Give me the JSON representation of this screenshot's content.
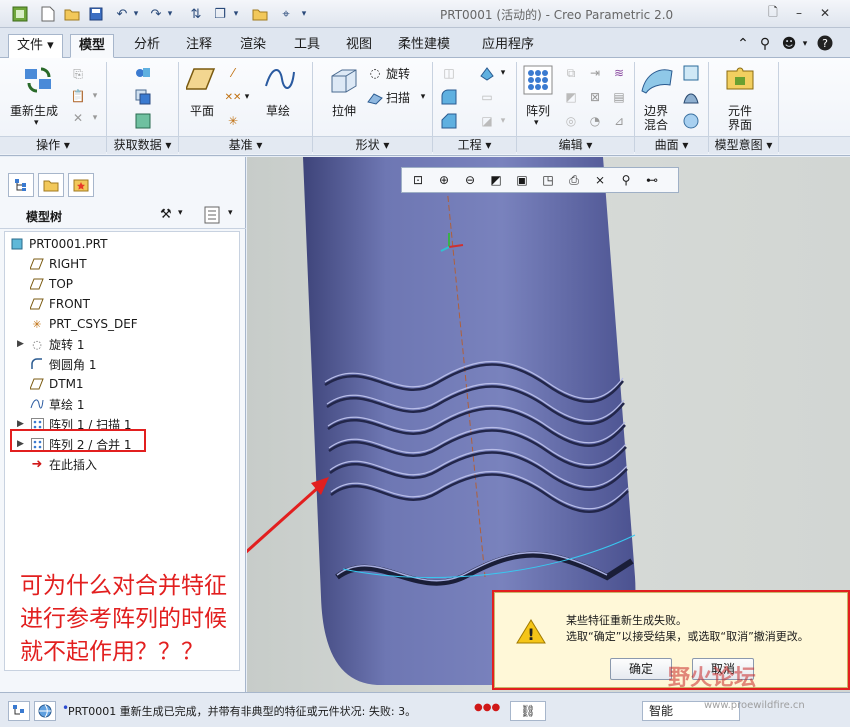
{
  "window": {
    "title": "PRT0001 (活动的) - Creo Parametric 2.0"
  },
  "ribbon_tabs": [
    {
      "label": "文件 ▾"
    },
    {
      "label": "模型"
    },
    {
      "label": "分析"
    },
    {
      "label": "注释"
    },
    {
      "label": "渲染"
    },
    {
      "label": "工具"
    },
    {
      "label": "视图"
    },
    {
      "label": "柔性建模"
    },
    {
      "label": "应用程序"
    }
  ],
  "ribbon": {
    "regenerate_label": "重新生成",
    "plane_label": "平面",
    "sketch_label": "草绘",
    "extrude_label": "拉伸",
    "revolve_label": "旋转",
    "sweep_label": "扫描",
    "pattern_label": "阵列",
    "boundary_blend_label_1": "边界",
    "boundary_blend_label_2": "混合",
    "component_interface_label_1": "元件",
    "component_interface_label_2": "界面",
    "groups": [
      {
        "label": "操作 ▾"
      },
      {
        "label": "获取数据 ▾"
      },
      {
        "label": "基准 ▾"
      },
      {
        "label": "形状 ▾"
      },
      {
        "label": "工程 ▾"
      },
      {
        "label": "编辑 ▾"
      },
      {
        "label": "曲面 ▾"
      },
      {
        "label": "模型意图 ▾"
      }
    ]
  },
  "model_tree": {
    "header": "模型树",
    "items": [
      {
        "label": "PRT0001.PRT",
        "icon": "part-icon"
      },
      {
        "label": "RIGHT",
        "icon": "datum-plane-icon"
      },
      {
        "label": "TOP",
        "icon": "datum-plane-icon"
      },
      {
        "label": "FRONT",
        "icon": "datum-plane-icon"
      },
      {
        "label": "PRT_CSYS_DEF",
        "icon": "csys-icon"
      },
      {
        "label": "旋转 1",
        "icon": "revolve-icon"
      },
      {
        "label": "倒圆角 1",
        "icon": "round-icon"
      },
      {
        "label": "DTM1",
        "icon": "datum-plane-icon"
      },
      {
        "label": "草绘 1",
        "icon": "sketch-icon"
      },
      {
        "label": "阵列 1 / 扫描 1",
        "icon": "pattern-icon"
      },
      {
        "label": "阵列 2 / 合并 1",
        "icon": "pattern-icon"
      },
      {
        "label": "在此插入",
        "icon": "insert-arrow-icon"
      }
    ]
  },
  "annotation": {
    "text": "可为什么对合并特征\n进行参考阵列的时候\n就不起作用？？？"
  },
  "dialog": {
    "line1": "某些特征重新生成失败。",
    "line2": "选取“确定”以接受结果，或选取“取消”撤消更改。",
    "ok_label": "确定",
    "cancel_label": "取消"
  },
  "statusbar": {
    "message": "PRT0001 重新生成已完成，并带有非典型的特征或元件状况: 失败: 3。",
    "filter_value": "智能"
  },
  "watermark": {
    "brand": "野火论坛",
    "url": "www.proewildfire.cn"
  },
  "colors": {
    "highlight": "#e21f1f",
    "model_body": "#6f78b3",
    "dialog_bg": "#fff8d8"
  }
}
